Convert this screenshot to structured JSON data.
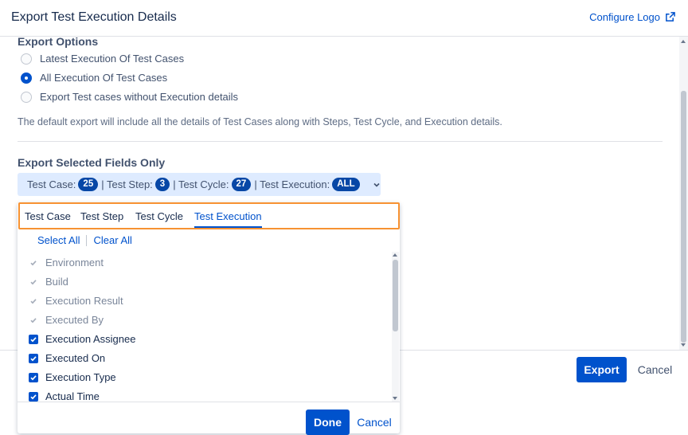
{
  "header": {
    "title": "Export Test Execution Details",
    "configure_logo": "Configure Logo"
  },
  "export_options": {
    "title": "Export Options",
    "options": [
      {
        "label": "Latest Execution Of Test Cases",
        "selected": false
      },
      {
        "label": "All Execution Of Test Cases",
        "selected": true
      },
      {
        "label": "Export Test cases without Execution details",
        "selected": false
      }
    ],
    "note": "The default export will include all the details of Test Cases along with Steps, Test Cycle, and Execution details."
  },
  "selected_fields": {
    "title": "Export Selected Fields Only",
    "summary": {
      "test_case_label": "Test Case:",
      "test_case_count": "25",
      "test_step_label": "| Test Step:",
      "test_step_count": "3",
      "test_cycle_label": "| Test Cycle:",
      "test_cycle_count": "27",
      "test_execution_label": "| Test Execution:",
      "test_execution_count": "ALL"
    }
  },
  "dropdown": {
    "tabs": [
      {
        "label": "Test Case",
        "active": false
      },
      {
        "label": "Test Step",
        "active": false
      },
      {
        "label": "Test Cycle",
        "active": false
      },
      {
        "label": "Test Execution",
        "active": true
      }
    ],
    "select_all": "Select All",
    "clear_all": "Clear All",
    "fields": [
      {
        "label": "Environment",
        "checked": true,
        "disabled": true
      },
      {
        "label": "Build",
        "checked": true,
        "disabled": true
      },
      {
        "label": "Execution Result",
        "checked": true,
        "disabled": true
      },
      {
        "label": "Executed By",
        "checked": true,
        "disabled": true
      },
      {
        "label": "Execution Assignee",
        "checked": true,
        "disabled": false
      },
      {
        "label": "Executed On",
        "checked": true,
        "disabled": false
      },
      {
        "label": "Execution Type",
        "checked": true,
        "disabled": false
      },
      {
        "label": "Actual Time",
        "checked": true,
        "disabled": false
      }
    ],
    "done": "Done",
    "cancel": "Cancel"
  },
  "footer": {
    "export": "Export",
    "cancel": "Cancel"
  },
  "colors": {
    "primary": "#0052cc",
    "badge": "#0747a6",
    "summary_bg": "#deebff",
    "highlight": "#f79232"
  }
}
